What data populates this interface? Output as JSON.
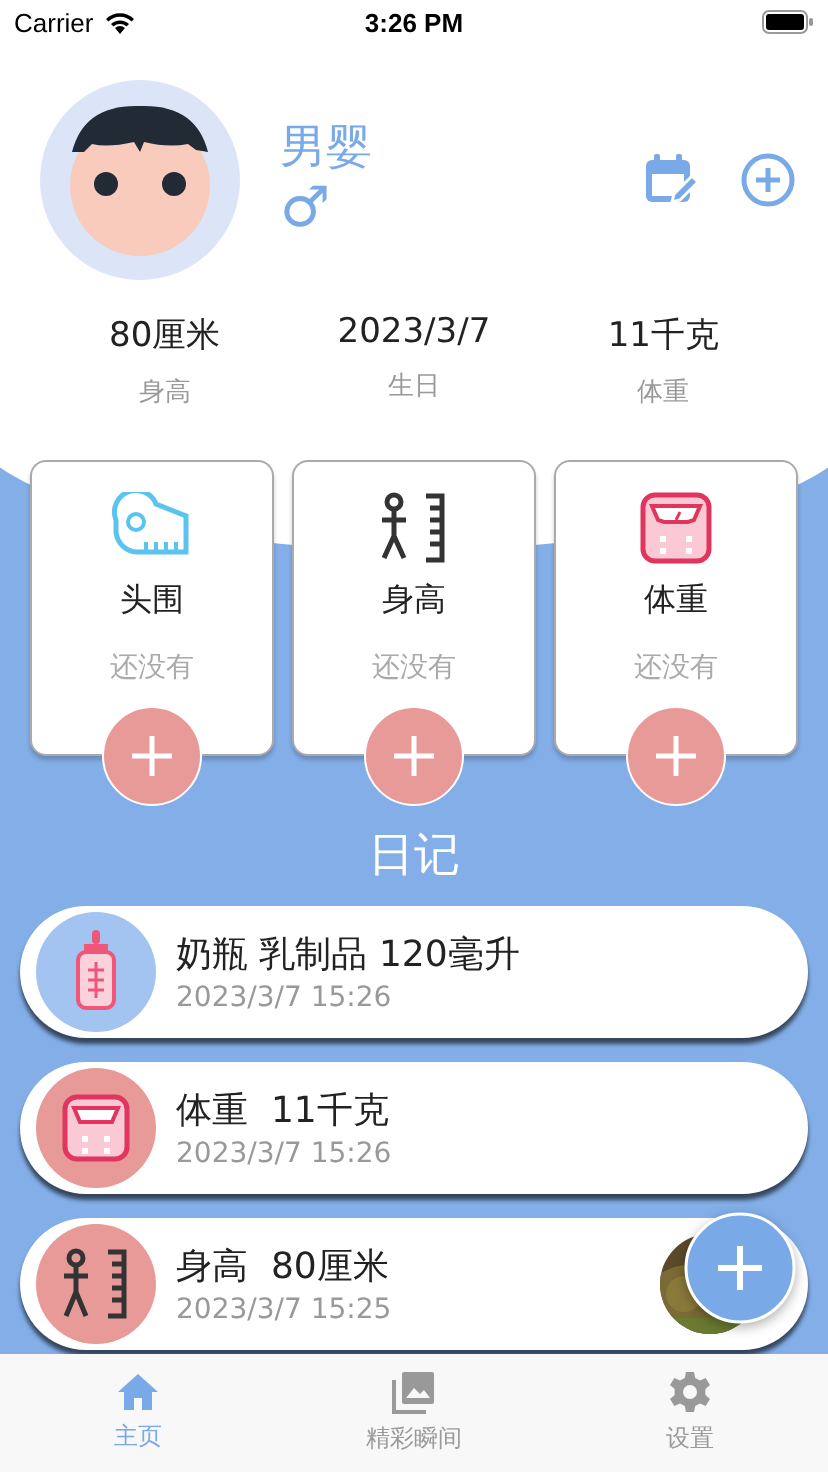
{
  "status_bar": {
    "carrier": "Carrier",
    "time": "3:26 PM"
  },
  "profile": {
    "name": "男婴",
    "gender_symbol": "♂"
  },
  "stats": [
    {
      "value": "80厘米",
      "label": "身高"
    },
    {
      "value": "2023/3/7",
      "label": "生日"
    },
    {
      "value": "11千克",
      "label": "体重"
    }
  ],
  "measure_cards": [
    {
      "kind": "tape",
      "title": "头围",
      "value": "还没有"
    },
    {
      "kind": "height",
      "title": "身高",
      "value": "还没有"
    },
    {
      "kind": "scale",
      "title": "体重",
      "value": "还没有"
    }
  ],
  "diary": {
    "title": "日记",
    "entries": [
      {
        "kind": "bottle",
        "color": "#a3c3f0",
        "title": "奶瓶 乳制品 120毫升",
        "time": "2023/3/7 15:26"
      },
      {
        "kind": "scale",
        "color": "#e89a98",
        "title": "体重  11千克",
        "time": "2023/3/7 15:26"
      },
      {
        "kind": "height",
        "color": "#e89a98",
        "title": "身高  80厘米",
        "time": "2023/3/7 15:25"
      }
    ]
  },
  "tabs": [
    {
      "kind": "home",
      "label": "主页",
      "selected": true
    },
    {
      "kind": "gallery",
      "label": "精彩瞬间",
      "selected": false
    },
    {
      "kind": "settings",
      "label": "设置",
      "selected": false
    }
  ]
}
